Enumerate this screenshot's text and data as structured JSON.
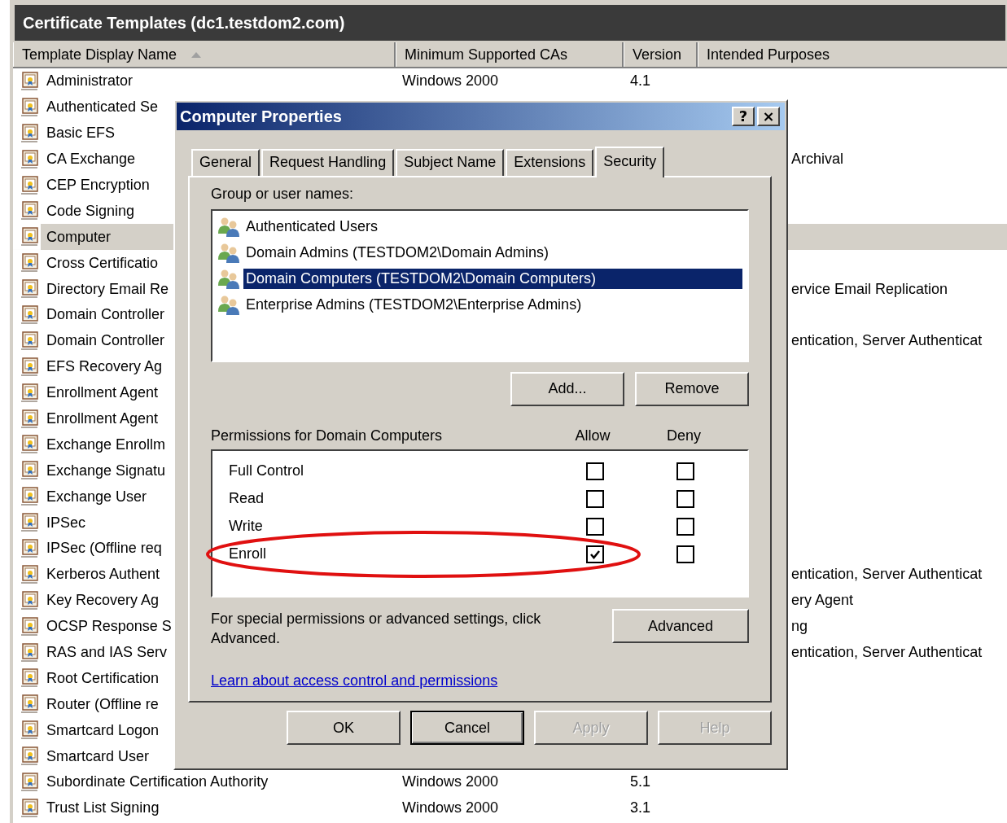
{
  "window": {
    "title": "Certificate Templates (dc1.testdom2.com)"
  },
  "table": {
    "columns": [
      {
        "label": "Template Display Name",
        "sorted": true
      },
      {
        "label": "Minimum Supported CAs",
        "sorted": false
      },
      {
        "label": "Version",
        "sorted": false
      },
      {
        "label": "Intended Purposes",
        "sorted": false
      }
    ],
    "rows": [
      {
        "name": "Administrator",
        "min_cas": "Windows 2000",
        "version": "4.1",
        "selected": false
      },
      {
        "name": "Authenticated Se",
        "selected": false
      },
      {
        "name": "Basic EFS",
        "selected": false
      },
      {
        "name": "CA Exchange",
        "purposes": "Archival",
        "selected": false
      },
      {
        "name": "CEP Encryption",
        "selected": false
      },
      {
        "name": "Code Signing",
        "selected": false
      },
      {
        "name": "Computer",
        "selected": true
      },
      {
        "name": "Cross Certificatio",
        "selected": false
      },
      {
        "name": "Directory Email Re",
        "purposes": "ervice Email Replication",
        "selected": false
      },
      {
        "name": "Domain Controller",
        "selected": false
      },
      {
        "name": "Domain Controller",
        "purposes": "entication, Server Authenticat",
        "selected": false
      },
      {
        "name": "EFS Recovery Ag",
        "selected": false
      },
      {
        "name": "Enrollment Agent",
        "selected": false
      },
      {
        "name": "Enrollment Agent",
        "selected": false
      },
      {
        "name": "Exchange Enrollm",
        "selected": false
      },
      {
        "name": "Exchange Signatu",
        "selected": false
      },
      {
        "name": "Exchange User",
        "selected": false
      },
      {
        "name": "IPSec",
        "selected": false
      },
      {
        "name": "IPSec (Offline req",
        "selected": false
      },
      {
        "name": "Kerberos Authent",
        "purposes": "entication, Server Authenticat",
        "selected": false
      },
      {
        "name": "Key Recovery Ag",
        "purposes": "ery Agent",
        "selected": false
      },
      {
        "name": "OCSP Response S",
        "purposes": "ng",
        "selected": false
      },
      {
        "name": "RAS and IAS Serv",
        "purposes": "entication, Server Authenticat",
        "selected": false
      },
      {
        "name": "Root Certification",
        "selected": false
      },
      {
        "name": "Router (Offline re",
        "selected": false
      },
      {
        "name": "Smartcard Logon",
        "selected": false
      },
      {
        "name": "Smartcard User",
        "selected": false
      },
      {
        "name": "Subordinate Certification Authority",
        "min_cas": "Windows 2000",
        "version": "5.1",
        "selected": false
      },
      {
        "name": "Trust List Signing",
        "min_cas": "Windows 2000",
        "version": "3.1",
        "selected": false
      }
    ]
  },
  "dialog": {
    "title": "Computer Properties",
    "help": "?",
    "close": "×",
    "tabs": [
      {
        "label": "General",
        "selected": false
      },
      {
        "label": "Request Handling",
        "selected": false
      },
      {
        "label": "Subject Name",
        "selected": false
      },
      {
        "label": "Extensions",
        "selected": false
      },
      {
        "label": "Security",
        "selected": true
      }
    ],
    "group_label": "Group or user names:",
    "users": [
      {
        "name": "Authenticated Users",
        "selected": false
      },
      {
        "name": "Domain Admins (TESTDOM2\\Domain Admins)",
        "selected": false
      },
      {
        "name": "Domain Computers (TESTDOM2\\Domain Computers)",
        "selected": true
      },
      {
        "name": "Enterprise Admins (TESTDOM2\\Enterprise Admins)",
        "selected": false
      }
    ],
    "user_buttons": [
      "Add...",
      "Remove"
    ],
    "permissions_label": "Permissions for Domain Computers",
    "allow_label": "Allow",
    "deny_label": "Deny",
    "permissions": [
      {
        "name": "Full Control",
        "allow": false,
        "deny": false,
        "circled": false
      },
      {
        "name": "Read",
        "allow": false,
        "deny": false,
        "circled": false
      },
      {
        "name": "Write",
        "allow": false,
        "deny": false,
        "circled": false
      },
      {
        "name": "Enroll",
        "allow": true,
        "deny": false,
        "circled": true
      }
    ],
    "advanced_text": "For special permissions or advanced settings, click Advanced.",
    "advanced_button": "Advanced",
    "link": "Learn about access control and permissions",
    "buttons": [
      {
        "label": "OK",
        "disabled": false,
        "focused": false
      },
      {
        "label": "Cancel",
        "disabled": false,
        "focused": true
      },
      {
        "label": "Apply",
        "disabled": true,
        "focused": false
      },
      {
        "label": "Help",
        "disabled": true,
        "focused": false
      }
    ]
  }
}
